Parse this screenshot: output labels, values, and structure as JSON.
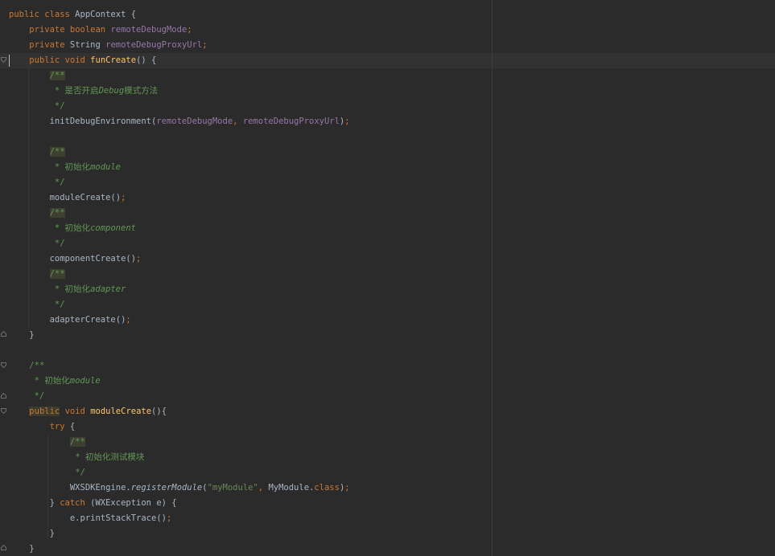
{
  "editor": {
    "theme": {
      "background": "#2b2b2b",
      "keyword": "#cc7832",
      "field": "#9876aa",
      "method": "#ffc66d",
      "doc_comment": "#629755",
      "string": "#6a8759",
      "default": "#a9b7c6"
    },
    "lines": [
      [
        {
          "t": "public class",
          "c": "kw"
        },
        {
          "t": " AppContext {"
        }
      ],
      [
        {
          "t": "    "
        },
        {
          "t": "private boolean",
          "c": "kw"
        },
        {
          "t": " "
        },
        {
          "t": "remoteDebugMode",
          "c": "fld"
        },
        {
          "t": ";",
          "c": "kw"
        }
      ],
      [
        {
          "t": "    "
        },
        {
          "t": "private",
          "c": "kw"
        },
        {
          "t": " String "
        },
        {
          "t": "remoteDebugProxyUrl",
          "c": "fld"
        },
        {
          "t": ";",
          "c": "kw"
        }
      ],
      [
        {
          "t": "    "
        },
        {
          "t": "public void",
          "c": "kw"
        },
        {
          "t": " "
        },
        {
          "t": "funCreate",
          "c": "fn"
        },
        {
          "t": "() {"
        }
      ],
      [
        {
          "t": "        "
        },
        {
          "t": "/**",
          "c": "doc hl-doc"
        }
      ],
      [
        {
          "t": "         "
        },
        {
          "t": "* 是否开启",
          "c": "doc"
        },
        {
          "t": "Debug",
          "c": "doc-i"
        },
        {
          "t": "模式方法",
          "c": "doc"
        }
      ],
      [
        {
          "t": "         "
        },
        {
          "t": "*/",
          "c": "doc"
        }
      ],
      [
        {
          "t": "        initDebugEnvironment("
        },
        {
          "t": "remoteDebugMode",
          "c": "fld"
        },
        {
          "t": ", ",
          "c": "kw"
        },
        {
          "t": "remoteDebugProxyUrl",
          "c": "fld"
        },
        {
          "t": ")"
        },
        {
          "t": ";",
          "c": "kw"
        }
      ],
      [
        {
          "t": ""
        }
      ],
      [
        {
          "t": "        "
        },
        {
          "t": "/**",
          "c": "doc hl-doc"
        }
      ],
      [
        {
          "t": "         "
        },
        {
          "t": "* 初始化",
          "c": "doc"
        },
        {
          "t": "module",
          "c": "doc-i"
        }
      ],
      [
        {
          "t": "         "
        },
        {
          "t": "*/",
          "c": "doc"
        }
      ],
      [
        {
          "t": "        moduleCreate()"
        },
        {
          "t": ";",
          "c": "kw"
        }
      ],
      [
        {
          "t": "        "
        },
        {
          "t": "/**",
          "c": "doc hl-doc"
        }
      ],
      [
        {
          "t": "         "
        },
        {
          "t": "* 初始化",
          "c": "doc"
        },
        {
          "t": "component",
          "c": "doc-i"
        }
      ],
      [
        {
          "t": "         "
        },
        {
          "t": "*/",
          "c": "doc"
        }
      ],
      [
        {
          "t": "        componentCreate()"
        },
        {
          "t": ";",
          "c": "kw"
        }
      ],
      [
        {
          "t": "        "
        },
        {
          "t": "/**",
          "c": "doc hl-doc"
        }
      ],
      [
        {
          "t": "         "
        },
        {
          "t": "* 初始化",
          "c": "doc"
        },
        {
          "t": "adapter",
          "c": "doc-i"
        }
      ],
      [
        {
          "t": "         "
        },
        {
          "t": "*/",
          "c": "doc"
        }
      ],
      [
        {
          "t": "        adapterCreate()"
        },
        {
          "t": ";",
          "c": "kw"
        }
      ],
      [
        {
          "t": "    }"
        }
      ],
      [
        {
          "t": ""
        }
      ],
      [
        {
          "t": "    "
        },
        {
          "t": "/**",
          "c": "doc"
        }
      ],
      [
        {
          "t": "     "
        },
        {
          "t": "* 初始化",
          "c": "doc"
        },
        {
          "t": "module",
          "c": "doc-i"
        }
      ],
      [
        {
          "t": "     "
        },
        {
          "t": "*/",
          "c": "doc"
        }
      ],
      [
        {
          "t": "    "
        },
        {
          "t": "public",
          "c": "kw hl"
        },
        {
          "t": " "
        },
        {
          "t": "void",
          "c": "kw"
        },
        {
          "t": " "
        },
        {
          "t": "moduleCreate",
          "c": "fn"
        },
        {
          "t": "(){"
        }
      ],
      [
        {
          "t": "        "
        },
        {
          "t": "try",
          "c": "kw"
        },
        {
          "t": " {"
        }
      ],
      [
        {
          "t": "            "
        },
        {
          "t": "/**",
          "c": "doc hl-doc"
        }
      ],
      [
        {
          "t": "             "
        },
        {
          "t": "* 初始化测试模块",
          "c": "doc"
        }
      ],
      [
        {
          "t": "             "
        },
        {
          "t": "*/",
          "c": "doc"
        }
      ],
      [
        {
          "t": "            WXSDKEngine."
        },
        {
          "t": "registerModule",
          "c": "static-m"
        },
        {
          "t": "("
        },
        {
          "t": "\"myModule\"",
          "c": "str"
        },
        {
          "t": ", ",
          "c": "kw"
        },
        {
          "t": "MyModule."
        },
        {
          "t": "class",
          "c": "kw"
        },
        {
          "t": ")"
        },
        {
          "t": ";",
          "c": "kw"
        }
      ],
      [
        {
          "t": "        } "
        },
        {
          "t": "catch",
          "c": "kw"
        },
        {
          "t": " (WXException e) {"
        }
      ],
      [
        {
          "t": "            e.printStackTrace()"
        },
        {
          "t": ";",
          "c": "kw"
        }
      ],
      [
        {
          "t": "        }"
        }
      ],
      [
        {
          "t": "    }"
        }
      ]
    ]
  }
}
